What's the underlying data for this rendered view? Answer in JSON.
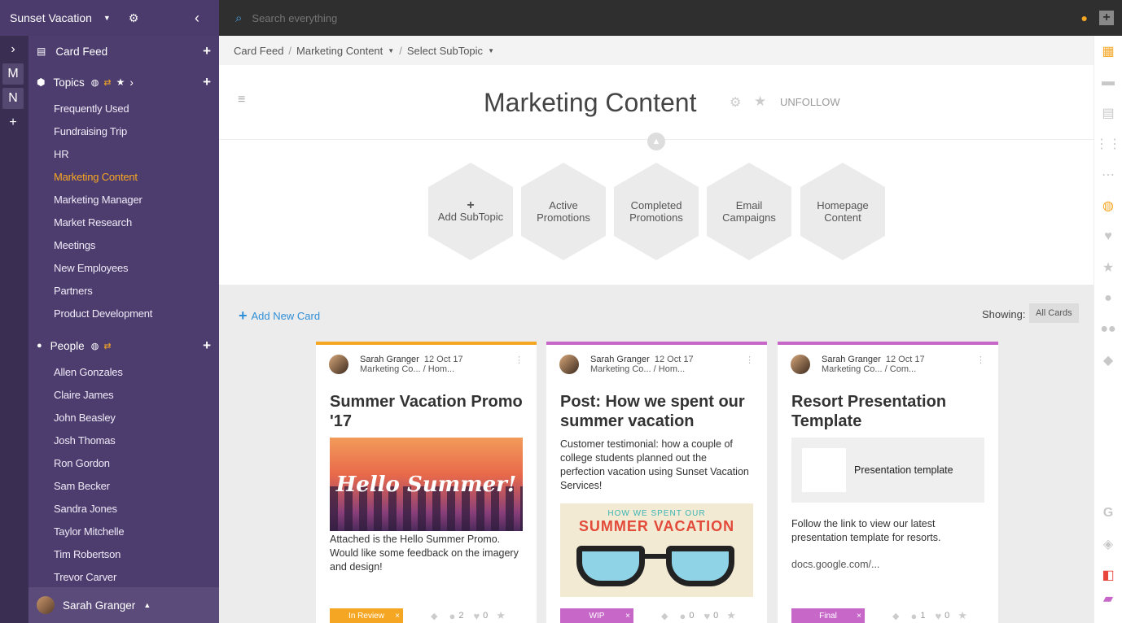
{
  "workspace": {
    "name": "Sunset Vacation"
  },
  "rail": {
    "m": "M",
    "n": "N"
  },
  "search": {
    "placeholder": "Search everything"
  },
  "sidebar": {
    "card_feed": "Card Feed",
    "topics_label": "Topics",
    "topics": [
      "Frequently Used",
      "Fundraising Trip",
      "HR",
      "Marketing Content",
      "Marketing Manager",
      "Market Research",
      "Meetings",
      "New Employees",
      "Partners",
      "Product Development"
    ],
    "people_label": "People",
    "people": [
      "Allen Gonzales",
      "Claire James",
      "John Beasley",
      "Josh Thomas",
      "Ron Gordon",
      "Sam Becker",
      "Sandra Jones",
      "Taylor Mitchelle",
      "Tim Robertson",
      "Trevor Carver"
    ],
    "user": "Sarah Granger"
  },
  "breadcrumb": [
    "Card Feed",
    "Marketing Content",
    "Select SubTopic"
  ],
  "page": {
    "title": "Marketing Content",
    "unfollow": "UNFOLLOW"
  },
  "subtopics": [
    "Add SubTopic",
    "Active Promotions",
    "Completed Promotions",
    "Email Campaigns",
    "Homepage Content"
  ],
  "cards_toolbar": {
    "add": "Add New Card",
    "showing": "Showing:",
    "filter": "All Cards"
  },
  "cards": [
    {
      "author": "Sarah Granger",
      "date": "12 Oct 17",
      "path": "Marketing Co... / Hom...",
      "title": "Summer Vacation Promo '17",
      "image_text": "Hello Summer!",
      "body": "Attached is the Hello Summer Promo. Would like some feedback on the imagery and design!",
      "status": "In Review",
      "comments": "2",
      "likes": "0",
      "color": "#f5a623"
    },
    {
      "author": "Sarah Granger",
      "date": "12 Oct 17",
      "path": "Marketing Co... / Hom...",
      "title": "Post: How we spent our summer vacation",
      "body": "Customer testimonial: how a couple of college students planned out the perfection vacation using Sunset Vacation Services!",
      "image_text": "HOW WE SPENT OUR",
      "image_text2": "SUMMER VACATION",
      "status": "WIP",
      "comments": "0",
      "likes": "0",
      "color": "#c768c9"
    },
    {
      "author": "Sarah Granger",
      "date": "12 Oct 17",
      "path": "Marketing Co... / Com...",
      "title": "Resort Presentation Template",
      "attachment": "Presentation template",
      "body": "Follow the link to view our latest presentation template for resorts.",
      "link": "docs.google.com/...",
      "status": "Final",
      "comments": "1",
      "likes": "0",
      "color": "#c768c9"
    }
  ]
}
